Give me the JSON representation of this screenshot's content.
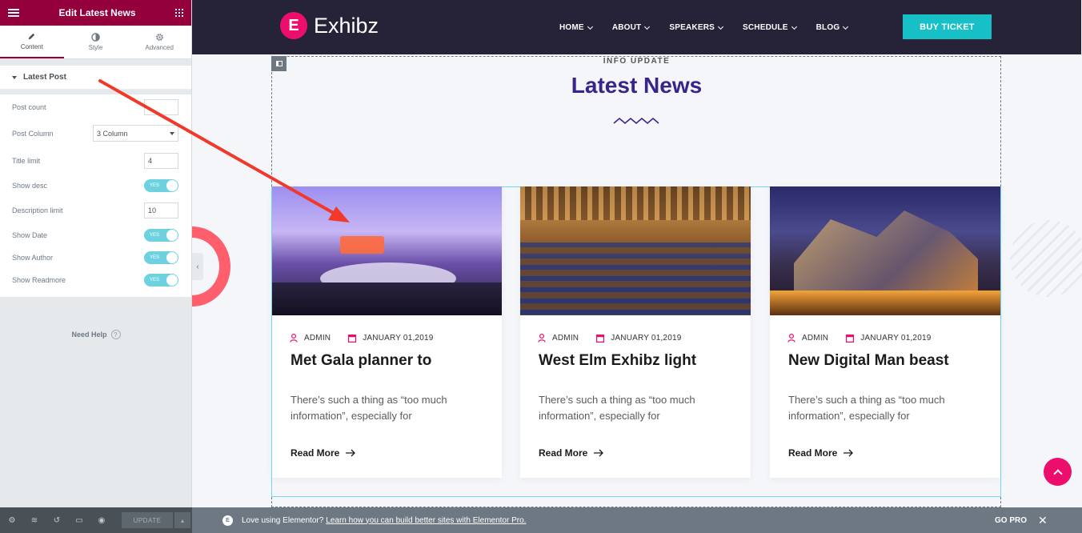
{
  "panel": {
    "header_title": "Edit Latest News",
    "tabs": [
      {
        "label": "Content",
        "icon": "pencil-icon"
      },
      {
        "label": "Style",
        "icon": "contrast-icon"
      },
      {
        "label": "Advanced",
        "icon": "gear-icon"
      }
    ],
    "section_title": "Latest Post",
    "controls": {
      "post_count_label": "Post count",
      "post_count_value": "",
      "post_column_label": "Post Column",
      "post_column_value": "3 Column",
      "title_limit_label": "Title limit",
      "title_limit_value": "4",
      "show_desc_label": "Show desc",
      "description_limit_label": "Description limit",
      "description_limit_value": "10",
      "show_date_label": "Show Date",
      "show_author_label": "Show Author",
      "show_readmore_label": "Show Readmore",
      "toggle_text": "YES"
    },
    "need_help": "Need Help",
    "help_icon": "?",
    "update_label": "UPDATE"
  },
  "site": {
    "logo_text": "Exhibz",
    "logo_mark": "E",
    "menu": [
      {
        "label": "HOME"
      },
      {
        "label": "ABOUT"
      },
      {
        "label": "SPEAKERS"
      },
      {
        "label": "SCHEDULE"
      },
      {
        "label": "BLOG"
      }
    ],
    "buy_label": "BUY TICKET",
    "eyebrow": "INFO UPDATE",
    "heading": "Latest News",
    "colors": {
      "brand": "#ec0d6d",
      "heading": "#39238d",
      "teal": "#17bfc7",
      "nav_bg": "#262339"
    }
  },
  "posts": [
    {
      "author": "ADMIN",
      "date": "JANUARY 01,2019",
      "title": "Met Gala planner to",
      "desc": "There’s such a thing as “too much information”, especially for",
      "more": "Read More"
    },
    {
      "author": "ADMIN",
      "date": "JANUARY 01,2019",
      "title": "West Elm Exhibz light",
      "desc": "There’s such a thing as “too much information”, especially for",
      "more": "Read More"
    },
    {
      "author": "ADMIN",
      "date": "JANUARY 01,2019",
      "title": "New Digital Man beast",
      "desc": "There’s such a thing as “too much information”, especially for",
      "more": "Read More"
    }
  ],
  "notice": {
    "message": "Love using Elementor?",
    "link": "Learn how you can build better sites with Elementor Pro.",
    "go_pro": "GO PRO",
    "close": "✕"
  }
}
